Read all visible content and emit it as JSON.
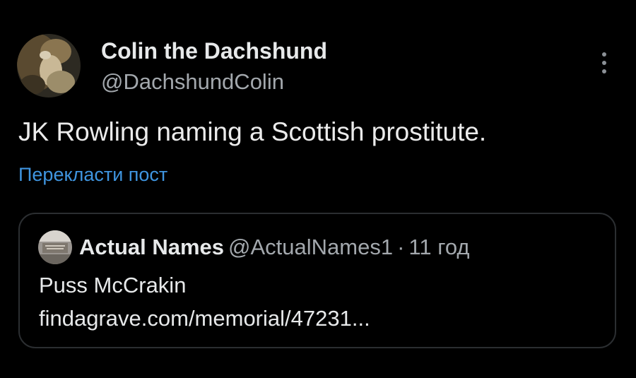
{
  "post": {
    "author": {
      "display_name": "Colin the Dachshund",
      "handle": "@DachshundColin",
      "avatar_icon": "dachshund-photo-avatar"
    },
    "more_icon": "more-vertical-icon",
    "text": "JK Rowling naming a Scottish prostitute.",
    "translate_label": "Перекласти пост"
  },
  "quoted_post": {
    "avatar_icon": "gravestone-photo-avatar",
    "display_name": "Actual Names",
    "handle": "@ActualNames1",
    "separator": "·",
    "time": "11 год",
    "line1": "Puss McCrakin",
    "line2": "findagrave.com/memorial/47231..."
  },
  "colors": {
    "background": "#000000",
    "primary_text": "#e7e9ea",
    "secondary_text": "#a3a8ad",
    "link": "#3f95e0",
    "card_border": "#2b2e31"
  }
}
